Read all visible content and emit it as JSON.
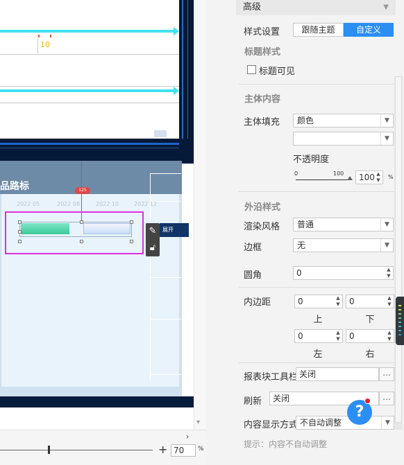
{
  "canvas": {
    "axis_value": "10",
    "panel_title": "品路标",
    "dates": [
      "2022 05",
      "2022 08",
      "2022 10",
      "2022 12"
    ],
    "badge": "125",
    "tab_text": "展开"
  },
  "zoom": {
    "value": "70",
    "unit": "%",
    "plus": "+"
  },
  "panel": {
    "header": "高级",
    "style_setting_label": "样式设置",
    "style_follow_theme": "跟随主题",
    "style_custom": "自定义",
    "title_style_section": "标题样式",
    "title_visible_label": "标题可见",
    "body_section": "主体内容",
    "body_fill_label": "主体填充",
    "body_fill_value": "颜色",
    "opacity_label": "不透明度",
    "opacity_min": "0",
    "opacity_max": "100",
    "opacity_value": "100",
    "opacity_unit": "%",
    "border_section": "外沿样式",
    "render_style_label": "渲染风格",
    "render_style_value": "普通",
    "border_label": "边框",
    "border_value": "无",
    "radius_label": "圆角",
    "radius_value": "0",
    "padding_label": "内边距",
    "padding_top_value": "0",
    "padding_bottom_value": "0",
    "padding_left_value": "0",
    "padding_right_value": "0",
    "padding_top_label": "上",
    "padding_bottom_label": "下",
    "padding_left_label": "左",
    "padding_right_label": "右",
    "toolbar_label": "报表块工具栏",
    "toolbar_value": "关闭",
    "refresh_label": "刷新",
    "refresh_value": "关闭",
    "display_mode_label": "内容显示方式",
    "display_mode_value": "不自动调整",
    "hint": "提示：内容不自动调整",
    "help_icon": "?",
    "ellipsis": "...",
    "accent_color": "#2b8ef3"
  }
}
